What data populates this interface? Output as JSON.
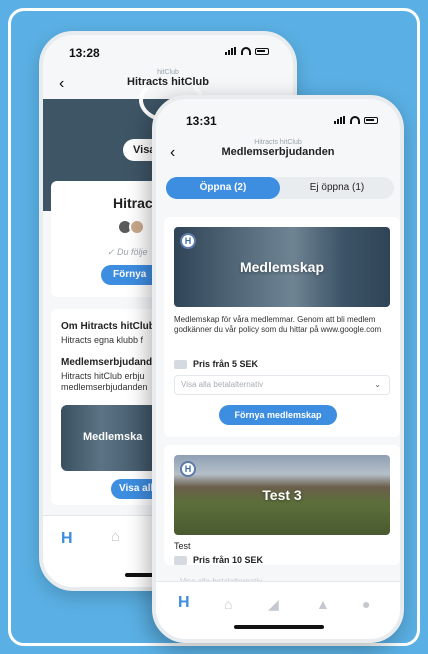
{
  "back_screen": {
    "status_time": "13:28",
    "header_subtitle": "hitClub",
    "header_title": "Hitracts hitClub",
    "visa_pill": "Visa",
    "club_name": "Hitrac",
    "follow_text": "✓ Du följe",
    "renew_button": "Förnya",
    "about_title": "Om Hitracts hitClub",
    "about_text": "Hitracts egna klubb f",
    "offers_title": "Medlemserbjudande",
    "offers_text": "Hitracts hitClub erbju medlemserbjudanden",
    "thumb_label": "Medlemska",
    "visa_alla_button": "Visa alla"
  },
  "front_screen": {
    "status_time": "13:31",
    "header_subtitle": "Hitracts hitClub",
    "header_title": "Medlemserbjudanden",
    "tabs": [
      {
        "label": "Öppna (2)",
        "active": true
      },
      {
        "label": "Ej öppna (1)",
        "active": false
      }
    ],
    "offers": [
      {
        "image_label": "Medlemskap",
        "description": "Medlemskap för våra medlemmar. Genom att bli medlem godkänner du vår policy som du hittar på www.google.com",
        "price": "Pris från 5 SEK",
        "select_placeholder": "Visa alla betalalternativ",
        "button": "Förnya medlemskap"
      },
      {
        "image_label": "Test 3",
        "description": "Test",
        "price": "Pris från 10 SEK",
        "select_placeholder": "Visa alla betalalternativ"
      }
    ]
  },
  "colors": {
    "background": "#5ab0e4",
    "accent": "#3d8de0"
  },
  "icons": [
    "chevron-left-icon",
    "signal-icon",
    "wifi-icon",
    "battery-icon",
    "club-logo-icon",
    "house-icon",
    "megaphone-icon",
    "bell-icon",
    "person-icon",
    "chevron-down-icon",
    "price-tag-icon"
  ]
}
